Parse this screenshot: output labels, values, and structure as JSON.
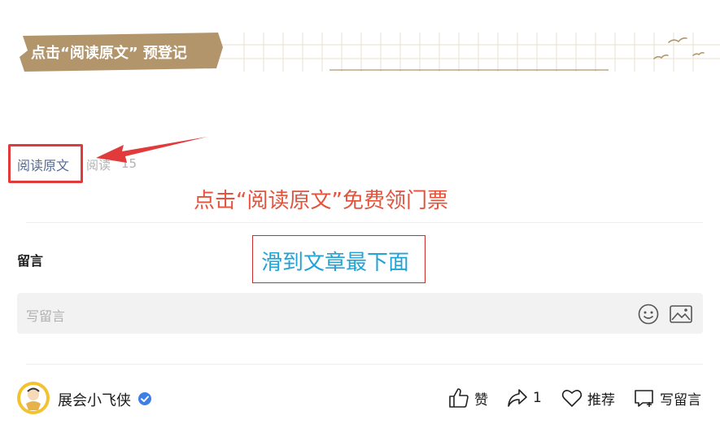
{
  "banner": {
    "label": "点击“阅读原文” 预登记",
    "colors": {
      "badge": "#b3956b",
      "lines": "#e6d9c6",
      "baseline": "#b3956b"
    }
  },
  "article_footer": {
    "read_original": "阅读原文",
    "read_count_label": "阅读",
    "read_count_value": "15"
  },
  "annotations": {
    "red_hint": "点击“阅读原文”免费领门票",
    "scroll_hint": "滑到文章最下面",
    "colors": {
      "red": "#e5533d",
      "blue": "#22a3d6"
    }
  },
  "comments": {
    "heading": "留言",
    "input_placeholder": "写留言",
    "icons": [
      "emoji-icon",
      "image-icon"
    ]
  },
  "bottom_bar": {
    "account_name": "展会小飞侠",
    "verified": true,
    "like_label": "赞",
    "share_count": "1",
    "recommend_label": "推荐",
    "write_comment_label": "写留言"
  }
}
